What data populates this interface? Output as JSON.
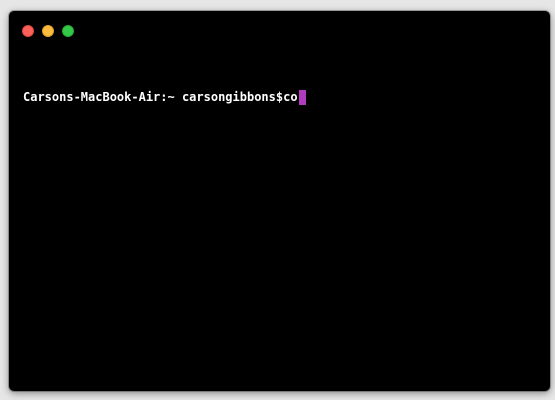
{
  "terminal": {
    "prompt": "Carsons-MacBook-Air:~ carsongibbons$",
    "typed_text": "co",
    "cursor_color": "#b13bbd"
  },
  "window_controls": {
    "close_color": "#fc605b",
    "minimize_color": "#fdbc40",
    "zoom_color": "#34c84a"
  }
}
